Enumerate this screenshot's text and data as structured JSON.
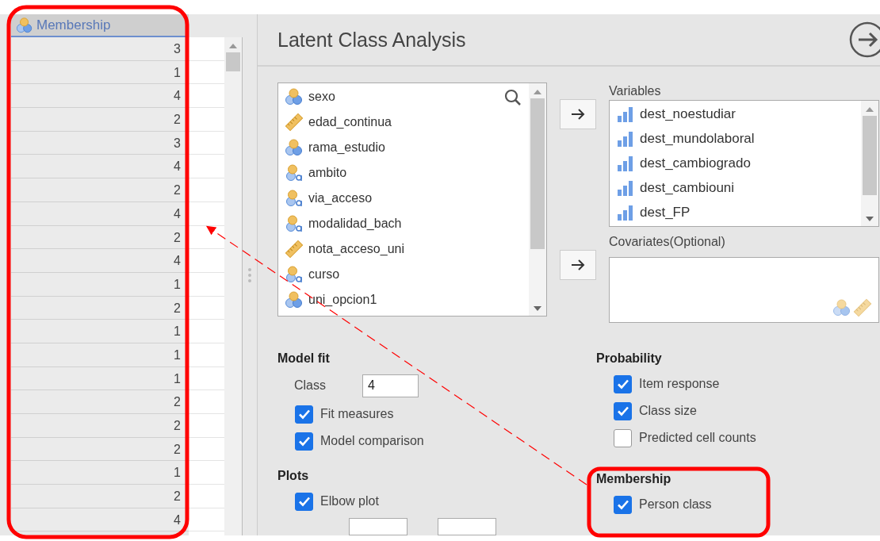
{
  "data_column": {
    "header": "Membership",
    "values": [
      "3",
      "1",
      "4",
      "2",
      "3",
      "4",
      "2",
      "4",
      "2",
      "4",
      "1",
      "2",
      "1",
      "1",
      "1",
      "2",
      "2",
      "2",
      "1",
      "2",
      "4"
    ]
  },
  "analysis": {
    "title": "Latent Class Analysis",
    "source_variables": [
      {
        "name": "sexo",
        "kind": "nominal"
      },
      {
        "name": "edad_continua",
        "kind": "continuous"
      },
      {
        "name": "rama_estudio",
        "kind": "nominal"
      },
      {
        "name": "ambito",
        "kind": "nominal_text"
      },
      {
        "name": "via_acceso",
        "kind": "nominal_text"
      },
      {
        "name": "modalidad_bach",
        "kind": "nominal_text"
      },
      {
        "name": "nota_acceso_uni",
        "kind": "continuous"
      },
      {
        "name": "curso",
        "kind": "nominal_text"
      },
      {
        "name": "uni_opcion1",
        "kind": "nominal"
      }
    ],
    "variables": {
      "label": "Variables",
      "items": [
        {
          "name": "dest_noestudiar",
          "kind": "ordinal"
        },
        {
          "name": "dest_mundolaboral",
          "kind": "ordinal"
        },
        {
          "name": "dest_cambiogrado",
          "kind": "ordinal"
        },
        {
          "name": "dest_cambiouni",
          "kind": "ordinal"
        },
        {
          "name": "dest_FP",
          "kind": "ordinal"
        }
      ]
    },
    "covariates": {
      "label": "Covariates(Optional)"
    },
    "model_fit": {
      "heading": "Model fit",
      "class_label": "Class",
      "class_value": "4",
      "options": [
        {
          "label": "Fit measures",
          "checked": true
        },
        {
          "label": "Model comparison",
          "checked": true
        }
      ]
    },
    "plots": {
      "heading": "Plots",
      "options": [
        {
          "label": "Elbow plot",
          "checked": true
        }
      ]
    },
    "probability": {
      "heading": "Probability",
      "options": [
        {
          "label": "Item response",
          "checked": true
        },
        {
          "label": "Class size",
          "checked": true
        },
        {
          "label": "Predicted cell counts",
          "checked": false
        }
      ]
    },
    "membership": {
      "heading": "Membership",
      "options": [
        {
          "label": "Person class",
          "checked": true
        }
      ]
    }
  }
}
